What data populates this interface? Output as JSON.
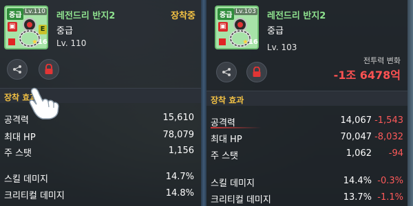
{
  "left_panel": {
    "grade_tag": "중급",
    "level_tag": "Lv.110",
    "item_name": "레전드리 반지2",
    "grade": "중급",
    "level": "Lv. 110",
    "star_count": "16",
    "equipped_label": "장착중",
    "section_title": "장착 효과",
    "stats": [
      {
        "label": "공격력",
        "value": "15,610"
      },
      {
        "label": "최대 HP",
        "value": "78,079"
      },
      {
        "label": "주 스탯",
        "value": "1,156"
      },
      {
        "label": "스킬 데미지",
        "value": "14.7%"
      },
      {
        "label": "크리티컬 데미지",
        "value": "14.8%"
      }
    ]
  },
  "right_panel": {
    "grade_tag": "중급",
    "level_tag": "Lv.103",
    "item_name": "레전드리 반지2",
    "grade": "중급",
    "level": "Lv. 103",
    "star_count": "16",
    "power_change_label": "전투력 변화",
    "power_change_value": "-1조 6478억",
    "section_title": "장착 효과",
    "stats": [
      {
        "label": "공격력",
        "value": "14,067",
        "diff": "-1,543"
      },
      {
        "label": "최대 HP",
        "value": "70,047",
        "diff": "-8,032"
      },
      {
        "label": "주 스탯",
        "value": "1,062",
        "diff": "-94"
      },
      {
        "label": "스킬 데미지",
        "value": "14.4%",
        "diff": "-0.3%"
      },
      {
        "label": "크리티컬 데미지",
        "value": "13.7%",
        "diff": "-1.1%"
      }
    ]
  },
  "colors": {
    "item_name": "#8fe28f",
    "gold_accent": "#f4c244",
    "decrease": "#ff5a5a"
  },
  "icons": {
    "share": "share-icon",
    "lock": "lock-icon",
    "hand": "pointing-hand-icon"
  }
}
